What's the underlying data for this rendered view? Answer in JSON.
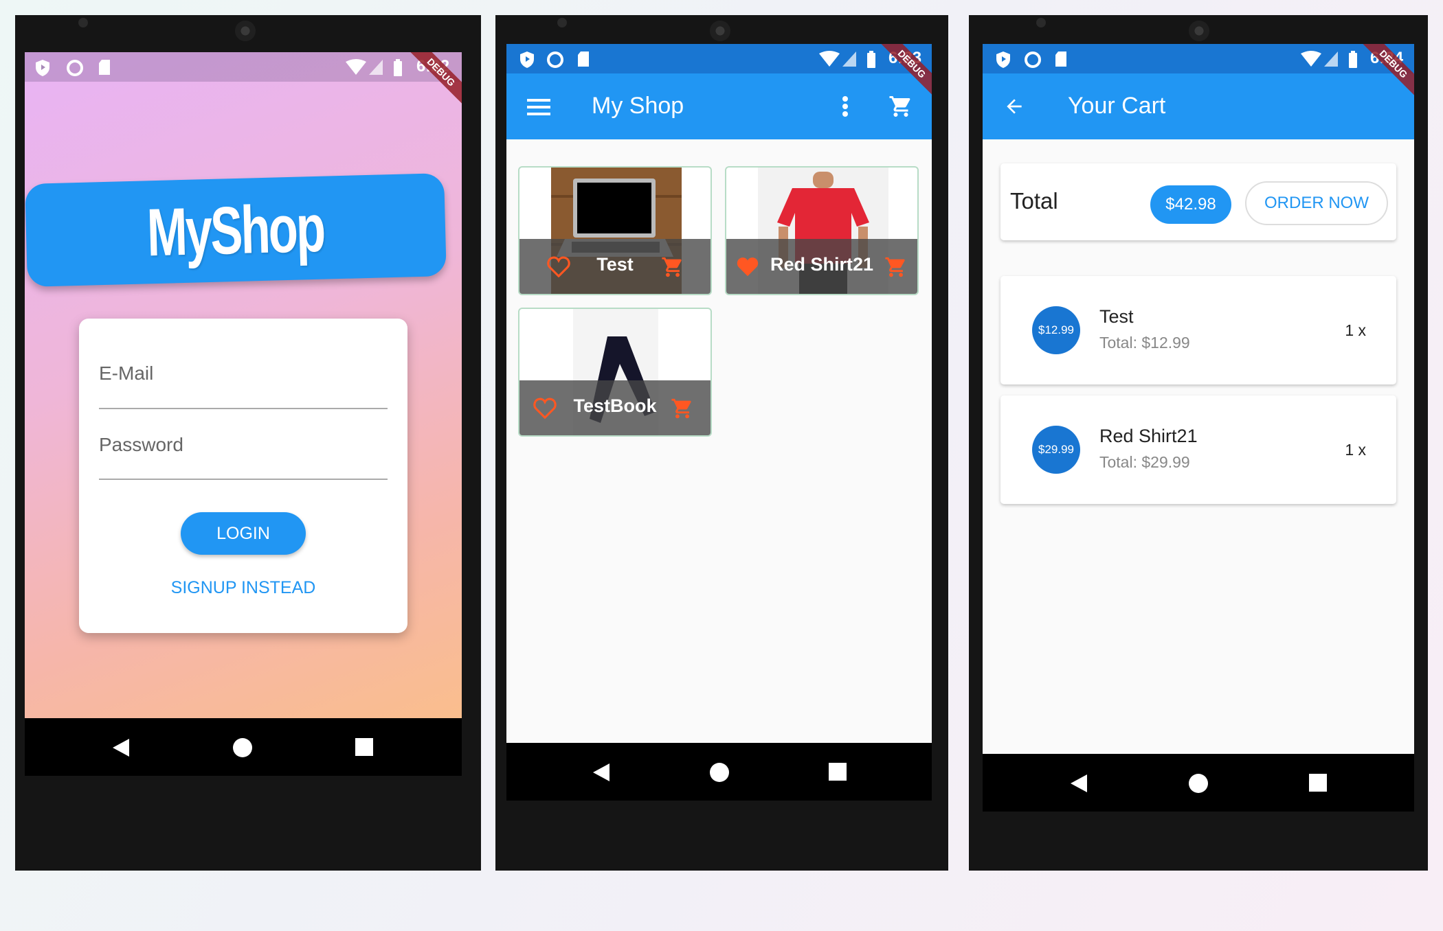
{
  "status_times": [
    "6:22",
    "6:23",
    "6:24"
  ],
  "debug_label": "DEBUG",
  "auth_screen": {
    "logo": "MyShop",
    "email_label": "E-Mail",
    "password_label": "Password",
    "login_button": "LOGIN",
    "signup_link": "SIGNUP INSTEAD"
  },
  "shop_screen": {
    "title": "My Shop",
    "products": [
      {
        "title": "Test",
        "favorite": false
      },
      {
        "title": "Red Shirt21",
        "favorite": true
      },
      {
        "title": "TestBook",
        "favorite": false
      }
    ]
  },
  "cart_screen": {
    "title": "Your Cart",
    "total_label": "Total",
    "total_amount": "$42.98",
    "order_button": "ORDER NOW",
    "items": [
      {
        "price": "$12.99",
        "title": "Test",
        "subtotal": "Total: $12.99",
        "qty": "1 x"
      },
      {
        "price": "$29.99",
        "title": "Red Shirt21",
        "subtotal": "Total: $29.99",
        "qty": "1 x"
      }
    ]
  },
  "colors": {
    "primary": "#2196f3",
    "accent": "#ff5722",
    "nav": "#000000"
  },
  "icons": [
    "shield-icon",
    "circle-icon",
    "sd-card-icon",
    "wifi-icon",
    "signal-icon",
    "battery-icon",
    "menu-icon",
    "more-vert-icon",
    "cart-icon",
    "arrow-back-icon",
    "heart-icon",
    "back-triangle-icon",
    "home-circle-icon",
    "recents-square-icon"
  ]
}
